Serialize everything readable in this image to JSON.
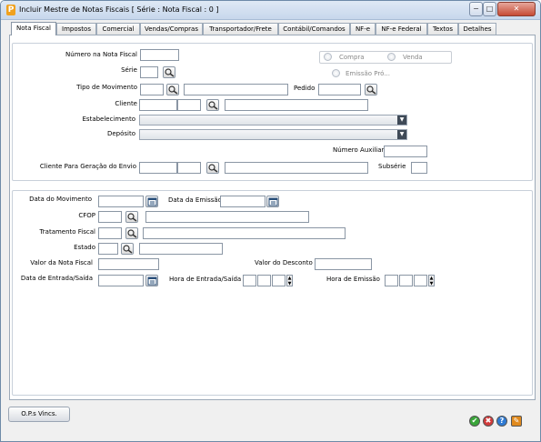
{
  "window": {
    "title": "Incluir Mestre de Notas Fiscais [ Série :    Nota Fiscal : 0 ]",
    "app_icon": "P",
    "minimize_glyph": "−",
    "maximize_glyph": "□",
    "close_glyph": "✕"
  },
  "tabs": [
    {
      "label": "Nota Fiscal",
      "active": true
    },
    {
      "label": "Impostos"
    },
    {
      "label": "Comercial"
    },
    {
      "label": "Vendas/Compras"
    },
    {
      "label": "Transportador/Frete"
    },
    {
      "label": "Contábil/Comandos"
    },
    {
      "label": "NF-e"
    },
    {
      "label": "NF-e Federal"
    },
    {
      "label": "Textos"
    },
    {
      "label": "Detalhes"
    }
  ],
  "section1": {
    "numero_na_nota_fiscal": "Número na Nota Fiscal",
    "serie": "Série",
    "tipo_de_movimento": "Tipo de Movimento",
    "pedido": "Pedido",
    "cliente": "Cliente",
    "estabelecimento": "Estabelecimento",
    "deposito": "Depósito",
    "numero_auxiliar": "Número Auxiliar",
    "cliente_geracao_envio": "Cliente Para Geração do Envio",
    "subserie": "Subsérie",
    "compra": "Compra",
    "venda": "Venda",
    "emissao_propria": "Emissão Pró..."
  },
  "section2": {
    "data_do_movimento": "Data do Movimento",
    "data_da_emissao": "Data da Emissão",
    "cfop": "CFOP",
    "tratamento_fiscal": "Tratamento Fiscal",
    "estado": "Estado",
    "valor_da_nota_fiscal": "Valor da Nota Fiscal",
    "valor_do_desconto": "Valor do Desconto",
    "data_entrada_saida": "Data de Entrada/Saída",
    "hora_entrada_saida": "Hora de Entrada/Saída",
    "hora_de_emissao": "Hora de Emissão"
  },
  "footer": {
    "ops_button": "O.P.s Vincs.",
    "confirm_glyph": "✔",
    "cancel_glyph": "✖",
    "help_glyph": "?",
    "tools_glyph": "✎"
  },
  "colors": {
    "confirm": "#3aa53a",
    "cancel": "#d23a3a",
    "help": "#2f7bd4",
    "tools": "#e08a1e"
  }
}
